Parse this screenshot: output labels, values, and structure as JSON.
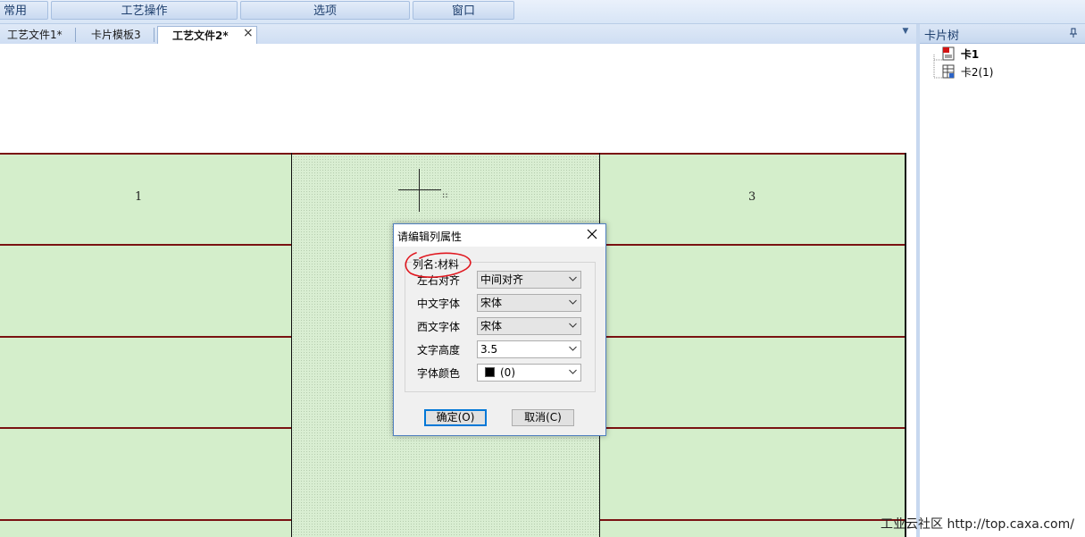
{
  "menu": {
    "items": [
      "常用",
      "工艺操作",
      "选项",
      "窗口"
    ]
  },
  "tabs": [
    {
      "label": "工艺文件1*"
    },
    {
      "label": "卡片模板3"
    },
    {
      "label": "工艺文件2*",
      "active": true
    }
  ],
  "tab_close_symbol": "×",
  "panel": {
    "title": "卡片树",
    "items": [
      {
        "label": "卡1",
        "bold": true
      },
      {
        "label": "卡2(1)",
        "bold": false
      }
    ]
  },
  "canvas": {
    "column_numbers": [
      "1",
      "3"
    ],
    "cursor_marker": "::"
  },
  "dialog": {
    "title": "请编辑列属性",
    "column_name_label": "列名:材料",
    "fields": [
      {
        "label": "左右对齐",
        "value": "中间对齐"
      },
      {
        "label": "中文字体",
        "value": "宋体"
      },
      {
        "label": "西文字体",
        "value": "宋体"
      },
      {
        "label": "文字高度",
        "value": "3.5"
      },
      {
        "label": "字体颜色",
        "value": "(0)"
      }
    ],
    "ok_label": "确定(O)",
    "cancel_label": "取消(C)"
  },
  "annotation_color": "#e0161e",
  "watermark": "工业云社区 http://top.caxa.com/"
}
